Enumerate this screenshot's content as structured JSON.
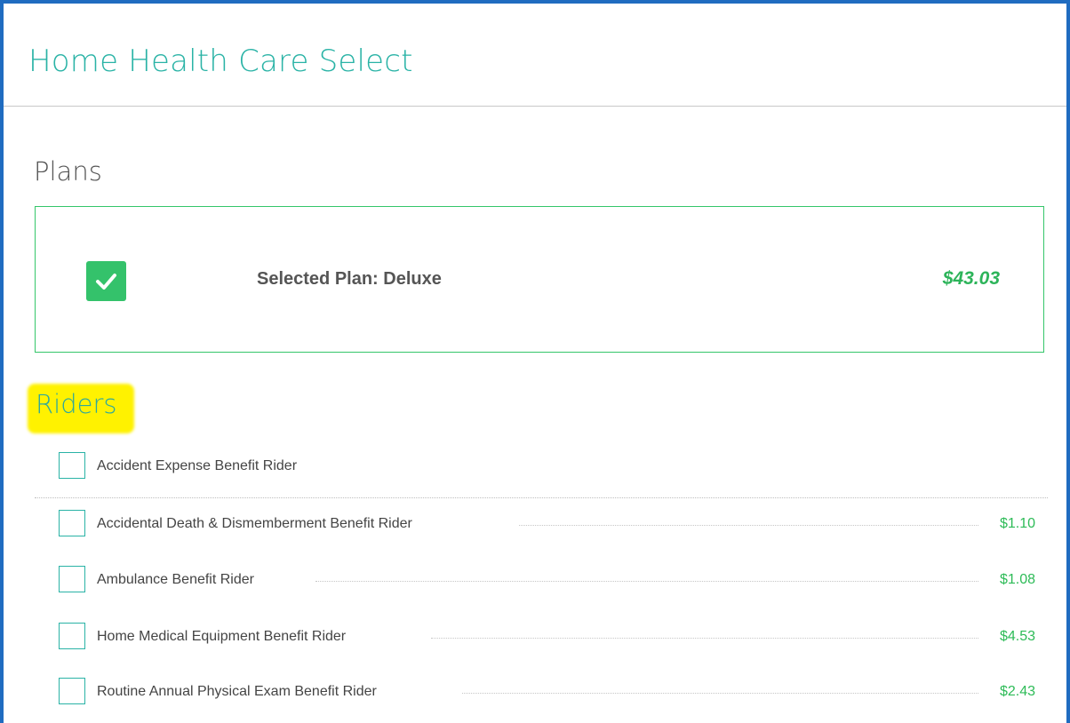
{
  "header": {
    "title": "Home Health Care Select"
  },
  "plans": {
    "section_title": "Plans",
    "selected_plan_label": "Selected Plan: Deluxe",
    "selected_plan_price": "$43.03",
    "checked": true
  },
  "riders": {
    "section_title": "Riders",
    "items": [
      {
        "label": "Accident Expense Benefit Rider",
        "price": "",
        "checked": false
      },
      {
        "label": "Accidental Death & Dismemberment Benefit Rider",
        "price": "$1.10",
        "checked": false
      },
      {
        "label": "Ambulance Benefit Rider",
        "price": "$1.08",
        "checked": false
      },
      {
        "label": "Home Medical Equipment Benefit Rider",
        "price": "$4.53",
        "checked": false
      },
      {
        "label": "Routine Annual Physical Exam Benefit Rider",
        "price": "$2.43",
        "checked": false
      }
    ]
  },
  "colors": {
    "frame_border": "#1f6cc0",
    "title_teal": "#2ab3a6",
    "plan_green": "#34c26b",
    "price_green": "#2dbb57",
    "highlight_yellow": "#fff200"
  },
  "icons": {
    "plan_checkbox": "checkmark-icon"
  }
}
